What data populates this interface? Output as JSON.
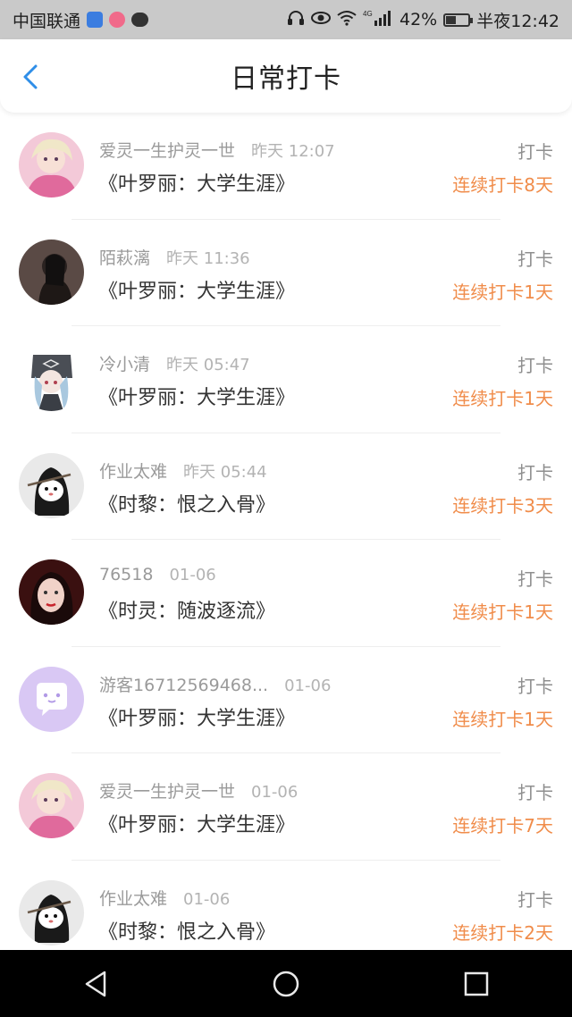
{
  "status_bar": {
    "carrier": "中国联通",
    "network": "4G",
    "battery": "42%",
    "battery_level": 0.42,
    "time": "半夜12:42"
  },
  "header": {
    "title": "日常打卡",
    "back_icon": "chevron-left-icon",
    "accent_color": "#2f8ee8"
  },
  "colors": {
    "streak": "#f08c4a",
    "meta": "#9a9a9a"
  },
  "checkins": [
    {
      "user": "爱灵一生护灵一世",
      "time": "昨天 12:07",
      "book": "《叶罗丽：大学生涯》",
      "action": "打卡",
      "streak": "连续打卡8天",
      "avatar": "avatar-pink-doll"
    },
    {
      "user": "陌萩漓",
      "time": "昨天 11:36",
      "book": "《叶罗丽：大学生涯》",
      "action": "打卡",
      "streak": "连续打卡1天",
      "avatar": "avatar-dark-girl"
    },
    {
      "user": "冷小清",
      "time": "昨天 05:47",
      "book": "《叶罗丽：大学生涯》",
      "action": "打卡",
      "streak": "连续打卡1天",
      "avatar": "avatar-hooded-anime"
    },
    {
      "user": "作业太难",
      "time": "昨天 05:44",
      "book": "《时黎：恨之入骨》",
      "action": "打卡",
      "streak": "连续打卡3天",
      "avatar": "avatar-grim-reaper"
    },
    {
      "user": "76518",
      "time": "01-06",
      "book": "《时灵：随波逐流》",
      "action": "打卡",
      "streak": "连续打卡1天",
      "avatar": "avatar-selfie"
    },
    {
      "user": "游客16712569468...",
      "time": "01-06",
      "book": "《叶罗丽：大学生涯》",
      "action": "打卡",
      "streak": "连续打卡1天",
      "avatar": "avatar-guest-chat"
    },
    {
      "user": "爱灵一生护灵一世",
      "time": "01-06",
      "book": "《叶罗丽：大学生涯》",
      "action": "打卡",
      "streak": "连续打卡7天",
      "avatar": "avatar-pink-doll"
    },
    {
      "user": "作业太难",
      "time": "01-06",
      "book": "《时黎：恨之入骨》",
      "action": "打卡",
      "streak": "连续打卡2天",
      "avatar": "avatar-grim-reaper"
    }
  ],
  "nav_bar": {
    "back_icon": "triangle-back-icon",
    "home_icon": "circle-home-icon",
    "recents_icon": "square-recents-icon"
  }
}
